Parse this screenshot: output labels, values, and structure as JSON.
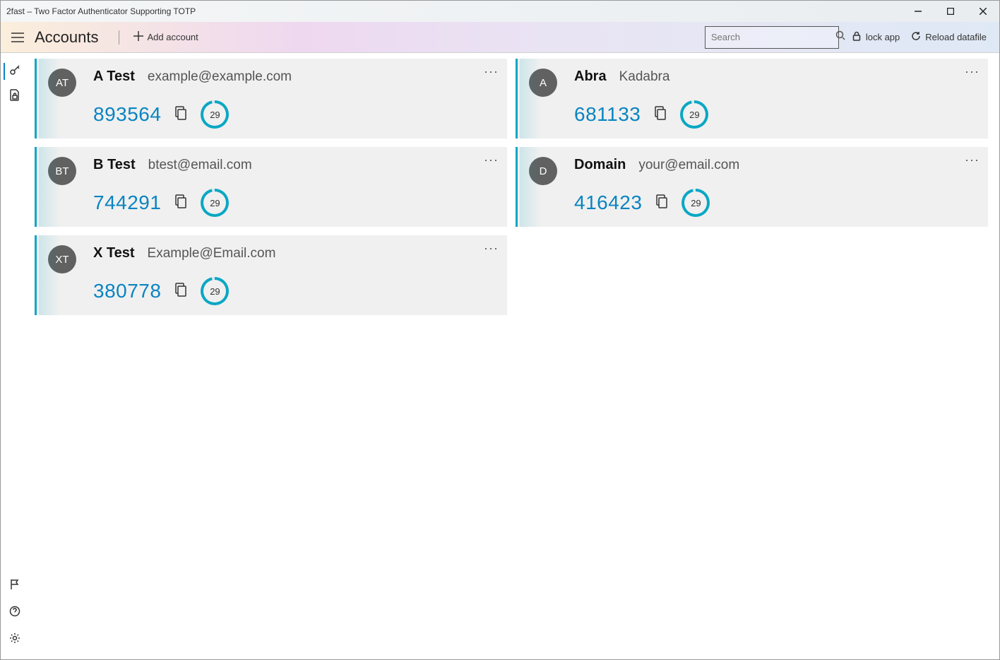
{
  "window": {
    "title": "2fast – Two Factor Authenticator Supporting TOTP"
  },
  "toolbar": {
    "page_title": "Accounts",
    "add_account": "Add account",
    "search_placeholder": "Search",
    "lock_app": "lock app",
    "reload": "Reload datafile"
  },
  "accounts": [
    {
      "initials": "AT",
      "name": "A Test",
      "user": "example@example.com",
      "code": "893564",
      "seconds": "29"
    },
    {
      "initials": "A",
      "name": "Abra",
      "user": "Kadabra",
      "code": "681133",
      "seconds": "29"
    },
    {
      "initials": "BT",
      "name": "B Test",
      "user": "btest@email.com",
      "code": "744291",
      "seconds": "29"
    },
    {
      "initials": "D",
      "name": "Domain",
      "user": "your@email.com",
      "code": "416423",
      "seconds": "29"
    },
    {
      "initials": "XT",
      "name": "X Test",
      "user": "Example@Email.com",
      "code": "380778",
      "seconds": "29"
    }
  ]
}
